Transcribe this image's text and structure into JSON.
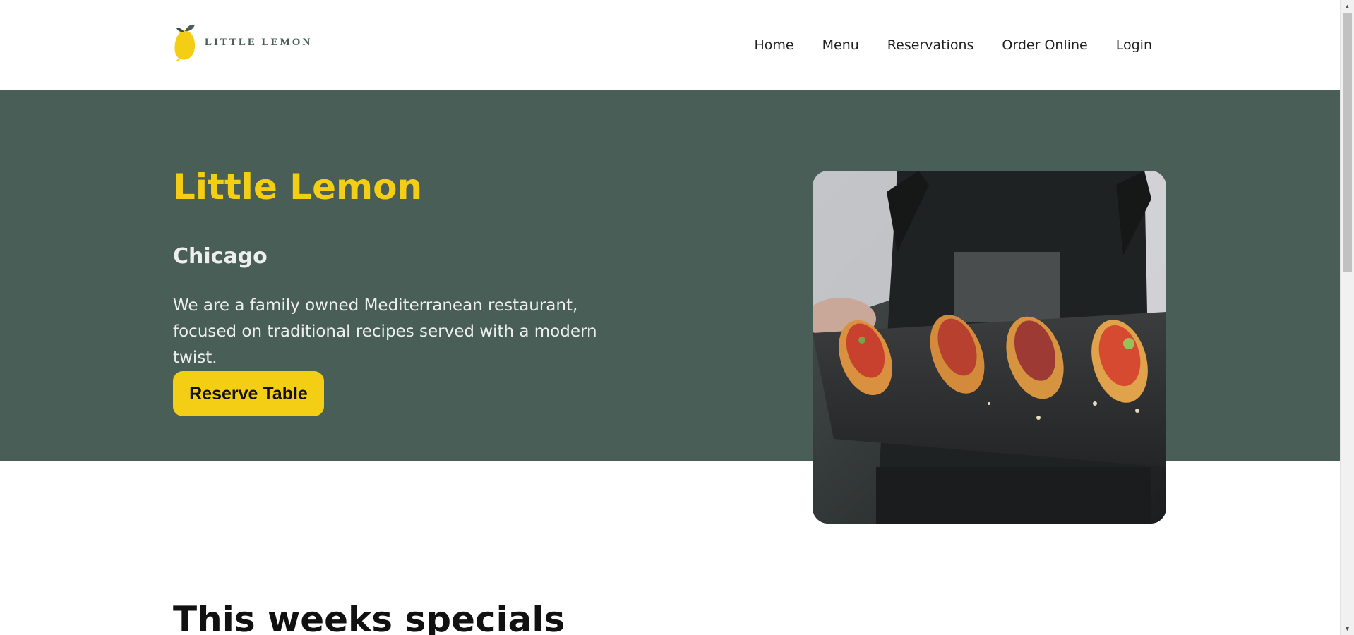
{
  "brand": {
    "logo_text": "LITTLE LEMON",
    "primary_color": "#495e57",
    "accent_color": "#f4ce14"
  },
  "nav": {
    "items": [
      "Home",
      "Menu",
      "Reservations",
      "Order Online",
      "Login"
    ]
  },
  "hero": {
    "title": "Little Lemon",
    "subtitle": "Chicago",
    "description": "We are a family owned Mediterranean restaurant, focused on traditional recipes served with a modern twist.",
    "cta_label": "Reserve Table",
    "image_icon": "food-photo"
  },
  "specials": {
    "title": "This weeks specials"
  },
  "scrollbar": {
    "up_icon": "triangle-up-icon",
    "down_icon": "triangle-down-icon"
  }
}
